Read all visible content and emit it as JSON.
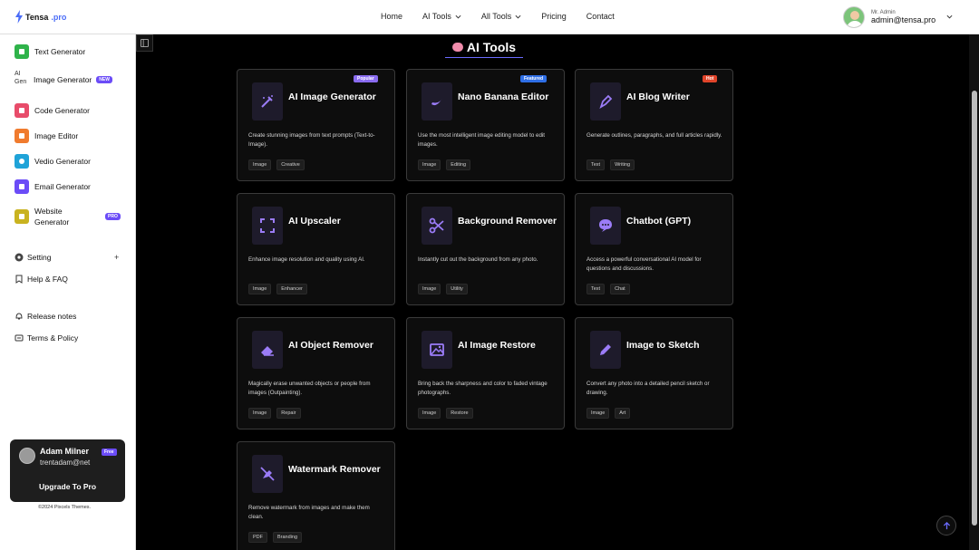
{
  "brand": {
    "name": "Tensa",
    "suffix": ".pro"
  },
  "nav": [
    {
      "label": "Home",
      "dropdown": false
    },
    {
      "label": "AI Tools",
      "dropdown": true
    },
    {
      "label": "All Tools",
      "dropdown": true
    },
    {
      "label": "Pricing",
      "dropdown": false
    },
    {
      "label": "Contact",
      "dropdown": false
    }
  ],
  "header_user": {
    "role": "Mr. Admin",
    "email": "admin@tensa.pro"
  },
  "sidebar": {
    "tools": [
      {
        "label": "Text Generator",
        "icon": "document-icon",
        "color": "#2fb34a"
      },
      {
        "label": "Image Generator",
        "icon": "broken-image-icon",
        "alt": "AI Gen",
        "badge": "NEW"
      },
      {
        "label": "Code Generator",
        "icon": "code-icon",
        "color": "#e84c6a"
      },
      {
        "label": "Image Editor",
        "icon": "image-edit-icon",
        "color": "#f07b2e"
      },
      {
        "label": "Vedio Generator",
        "icon": "video-icon",
        "color": "#1fa3d8"
      },
      {
        "label": "Email Generator",
        "icon": "email-icon",
        "color": "#6b4cf7"
      },
      {
        "label": "Website Generator",
        "icon": "website-icon",
        "color": "#c9b320",
        "badge": "PRO"
      }
    ],
    "setting": "Setting",
    "help": "Help & FAQ",
    "release": "Release notes",
    "terms": "Terms & Policy",
    "user_card": {
      "name": "Adam Milner",
      "plan": "Free",
      "email": "trentadam@net",
      "upgrade": "Upgrade To Pro"
    },
    "copyright": "©2024 Pixcels Themes."
  },
  "page_title": "AI Tools",
  "cards": [
    {
      "title": "AI Image Generator",
      "desc": "Create stunning images from text prompts (Text-to-Image).",
      "tags": [
        "Image",
        "Creative"
      ],
      "badge": "Popular",
      "icon": "magic-wand-icon"
    },
    {
      "title": "Nano Banana Editor",
      "desc": "Use the most intelligent image editing model to edit images.",
      "tags": [
        "Image",
        "Editing"
      ],
      "badge": "Featured",
      "icon": "banana-icon"
    },
    {
      "title": "AI Blog Writer",
      "desc": "Generate outlines, paragraphs, and full articles rapidly.",
      "tags": [
        "Text",
        "Writing"
      ],
      "badge": "Hot",
      "icon": "pen-nib-icon"
    },
    {
      "title": "AI Upscaler",
      "desc": "Enhance image resolution and quality using AI.",
      "tags": [
        "Image",
        "Enhancer"
      ],
      "icon": "expand-icon"
    },
    {
      "title": "Background Remover",
      "desc": "Instantly cut out the background from any photo.",
      "tags": [
        "Image",
        "Utility"
      ],
      "icon": "scissors-icon"
    },
    {
      "title": "Chatbot (GPT)",
      "desc": "Access a powerful conversational AI model for questions and discussions.",
      "tags": [
        "Text",
        "Chat"
      ],
      "icon": "chat-icon"
    },
    {
      "title": "AI Object Remover",
      "desc": "Magically erase unwanted objects or people from images (Outpainting).",
      "tags": [
        "Image",
        "Repair"
      ],
      "icon": "eraser-icon"
    },
    {
      "title": "AI Image Restore",
      "desc": "Bring back the sharpness and color to faded vintage photographs.",
      "tags": [
        "Image",
        "Restore"
      ],
      "icon": "photo-icon"
    },
    {
      "title": "Image to Sketch",
      "desc": "Convert any photo into a detailed pencil sketch or drawing.",
      "tags": [
        "Image",
        "Art"
      ],
      "icon": "pencil-icon"
    },
    {
      "title": "Watermark Remover",
      "desc": "Remove watermark from images and make them clean.",
      "tags": [
        "PDF",
        "Branding"
      ],
      "icon": "no-stamp-icon"
    }
  ]
}
